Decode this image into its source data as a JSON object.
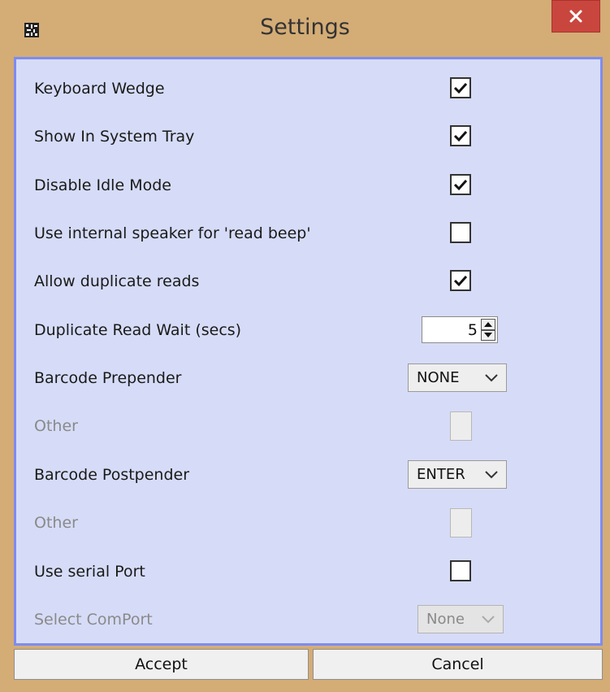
{
  "window": {
    "title": "Settings",
    "icon": "app-icon",
    "close_icon": "close-icon",
    "accent": "#c9463e"
  },
  "settings": {
    "keyboard_wedge": {
      "label": "Keyboard Wedge",
      "checked": true
    },
    "show_in_tray": {
      "label": "Show In System Tray",
      "checked": true
    },
    "disable_idle": {
      "label": "Disable Idle Mode",
      "checked": true
    },
    "internal_speaker": {
      "label": "Use internal speaker for 'read beep'",
      "checked": false
    },
    "allow_duplicates": {
      "label": "Allow duplicate reads",
      "checked": true
    },
    "duplicate_wait": {
      "label": "Duplicate Read Wait (secs)",
      "value": "5"
    },
    "prepender": {
      "label": "Barcode Prepender",
      "value": "NONE"
    },
    "prepender_other": {
      "label": "Other",
      "enabled": false
    },
    "postpender": {
      "label": "Barcode Postpender",
      "value": "ENTER"
    },
    "postpender_other": {
      "label": "Other",
      "enabled": false
    },
    "serial_port": {
      "label": "Use serial Port",
      "checked": false
    },
    "com_port": {
      "label": "Select ComPort",
      "value": "None",
      "enabled": false
    }
  },
  "buttons": {
    "accept": "Accept",
    "cancel": "Cancel"
  }
}
